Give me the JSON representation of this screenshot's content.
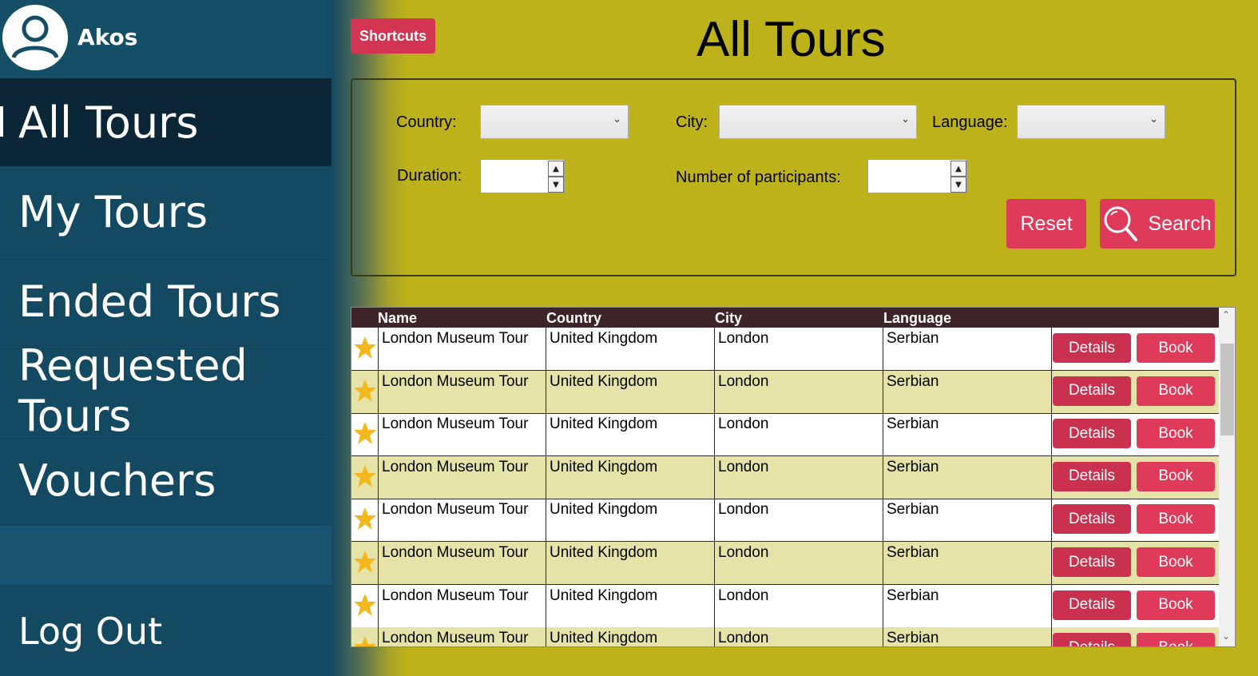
{
  "user": {
    "name": "Akos"
  },
  "nav": {
    "items": [
      {
        "label": "All Tours",
        "active": true
      },
      {
        "label": "My Tours"
      },
      {
        "label": "Ended Tours"
      },
      {
        "label": "Requested Tours"
      },
      {
        "label": "Vouchers"
      }
    ],
    "logout": "Log Out"
  },
  "header": {
    "title": "All Tours",
    "shortcuts": "Shortcuts"
  },
  "filters": {
    "country_label": "Country:",
    "city_label": "City:",
    "language_label": "Language:",
    "duration_label": "Duration:",
    "participants_label": "Number of participants:",
    "reset": "Reset",
    "search": "Search"
  },
  "table": {
    "columns": [
      "Name",
      "Country",
      "City",
      "Language"
    ],
    "details_label": "Details",
    "book_label": "Book",
    "rows": [
      {
        "name": "London Museum Tour",
        "country": "United Kingdom",
        "city": "London",
        "language": "Serbian"
      },
      {
        "name": "London Museum Tour",
        "country": "United Kingdom",
        "city": "London",
        "language": "Serbian"
      },
      {
        "name": "London Museum Tour",
        "country": "United Kingdom",
        "city": "London",
        "language": "Serbian"
      },
      {
        "name": "London Museum Tour",
        "country": "United Kingdom",
        "city": "London",
        "language": "Serbian"
      },
      {
        "name": "London Museum Tour",
        "country": "United Kingdom",
        "city": "London",
        "language": "Serbian"
      },
      {
        "name": "London Museum Tour",
        "country": "United Kingdom",
        "city": "London",
        "language": "Serbian"
      },
      {
        "name": "London Museum Tour",
        "country": "United Kingdom",
        "city": "London",
        "language": "Serbian"
      },
      {
        "name": "London Museum Tour",
        "country": "United Kingdom",
        "city": "London",
        "language": "Serbian"
      }
    ]
  },
  "icons": {
    "avatar": "user-avatar-icon",
    "search": "magnifier-icon",
    "star": "star-icon"
  },
  "colors": {
    "sidebar": "#134a62",
    "background": "#bdb219",
    "accent": "#df3a5a",
    "header_row": "#3d2428"
  }
}
